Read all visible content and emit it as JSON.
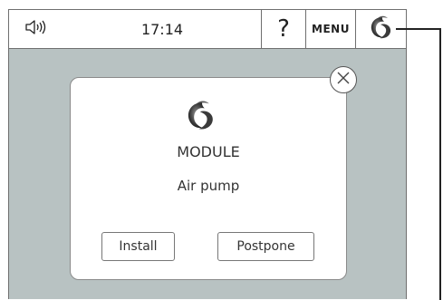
{
  "topbar": {
    "sound_icon": "speaker-volume-icon",
    "time": "17:14",
    "help_label": "?",
    "menu_label": "MENU",
    "logo_icon": "swirl-logo-icon"
  },
  "dialog": {
    "logo_icon": "swirl-logo-icon",
    "title": "MODULE",
    "module_name": "Air pump",
    "install_label": "Install",
    "postpone_label": "Postpone",
    "close_icon": "close-icon"
  },
  "colors": {
    "screen_background": "#b8c2c2",
    "panel": "#ffffff",
    "border": "#6f6f6f"
  }
}
